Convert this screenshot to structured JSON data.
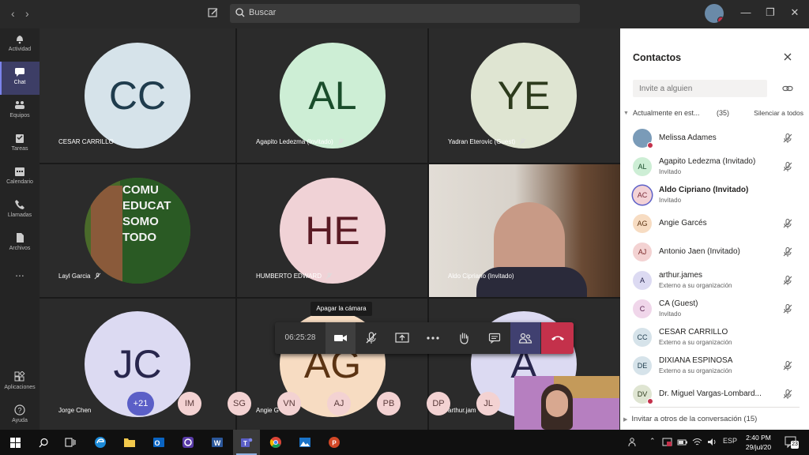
{
  "search": {
    "placeholder": "Buscar"
  },
  "rail": {
    "items": [
      {
        "label": "Actividad",
        "icon": "bell-icon"
      },
      {
        "label": "Chat",
        "icon": "chat-icon"
      },
      {
        "label": "Equipos",
        "icon": "teams-icon"
      },
      {
        "label": "Tareas",
        "icon": "tasks-icon"
      },
      {
        "label": "Calendario",
        "icon": "calendar-icon"
      },
      {
        "label": "Llamadas",
        "icon": "phone-icon"
      },
      {
        "label": "Archivos",
        "icon": "files-icon"
      },
      {
        "label": "Aplicaciones",
        "icon": "apps-icon"
      },
      {
        "label": "Ayuda",
        "icon": "help-icon"
      }
    ],
    "more": "..."
  },
  "tiles": [
    {
      "initials": "CC",
      "name": "CESAR CARRILLO",
      "bg": "#d6e3ea",
      "fg": "#1f3c4d"
    },
    {
      "initials": "AL",
      "name": "Agapito Ledezma (Invitado)",
      "bg": "#cdeed5",
      "fg": "#1a4d2b"
    },
    {
      "initials": "YE",
      "name": "Yadran Eterovic (Guest)",
      "bg": "#dfe5d2",
      "fg": "#2c3a1c"
    },
    {
      "initials": "",
      "name": "Layl Garcia",
      "bg": "#4a6a2a",
      "fg": "#ffffff",
      "photo_text": "COMU EDUCAT SOMO TODO"
    },
    {
      "initials": "HE",
      "name": "HUMBERTO EDWARD",
      "bg": "#f0d2d6",
      "fg": "#5a1a24"
    },
    {
      "initials": "",
      "name": "Aldo Cipriano (Invitado)",
      "bg": "#d8d0c8",
      "fg": "#ffffff"
    },
    {
      "initials": "JC",
      "name": "Jorge Chen",
      "bg": "#dcdaf2",
      "fg": "#28264d"
    },
    {
      "initials": "AG",
      "name": "Angie G",
      "bg": "#f7dcc2",
      "fg": "#5c3413"
    },
    {
      "initials": "A",
      "name": "arthur.jam",
      "bg": "#dcdaf2",
      "fg": "#28264d"
    }
  ],
  "tooltip": "Apagar la cámara",
  "controls": {
    "timer": "06:25:28"
  },
  "overflow": {
    "count": "+21",
    "avatars": [
      {
        "initials": "IM",
        "bg": "#f3d2d2"
      },
      {
        "initials": "SG",
        "bg": "#f3d2d2"
      },
      {
        "initials": "VN",
        "bg": "#f3d2d2"
      },
      {
        "initials": "AJ",
        "bg": "#f3d2d2"
      },
      {
        "initials": "PB",
        "bg": "#f3d2d2"
      },
      {
        "initials": "DP",
        "bg": "#f3d2d2"
      },
      {
        "initials": "JL",
        "bg": "#f3d2d2"
      }
    ]
  },
  "panel": {
    "title": "Contactos",
    "invite_placeholder": "Invite a alguien",
    "section_label": "Actualmente en est...",
    "section_count": "(35)",
    "mute_all": "Silenciar a todos",
    "contacts": [
      {
        "initials": "",
        "name": "Melissa Adames",
        "sub": "",
        "bg": "#7a9bb8",
        "fg": "#ffffff",
        "bold": false
      },
      {
        "initials": "AL",
        "name": "Agapito Ledezma (Invitado)",
        "sub": "Invitado",
        "bg": "#cdeed5",
        "fg": "#1a4d2b",
        "bold": false
      },
      {
        "initials": "AC",
        "name": "Aldo Cipriano (Invitado)",
        "sub": "Invitado",
        "bg": "#f3d2d6",
        "fg": "#7a2a36",
        "bold": true
      },
      {
        "initials": "AG",
        "name": "Angie Garcés",
        "sub": "",
        "bg": "#f7dcc2",
        "fg": "#5c3413",
        "bold": false
      },
      {
        "initials": "AJ",
        "name": "Antonio Jaen (Invitado)",
        "sub": "",
        "bg": "#f3d2d2",
        "fg": "#7a2a2a",
        "bold": false
      },
      {
        "initials": "A",
        "name": "arthur.james",
        "sub": "Externo a su organización",
        "bg": "#dcdaf2",
        "fg": "#28264d",
        "bold": false
      },
      {
        "initials": "C",
        "name": "CA (Guest)",
        "sub": "Invitado",
        "bg": "#f0d6ea",
        "fg": "#5a2450",
        "bold": false
      },
      {
        "initials": "CC",
        "name": "CESAR CARRILLO",
        "sub": "Externo a su organización",
        "bg": "#d6e3ea",
        "fg": "#1f3c4d",
        "bold": false
      },
      {
        "initials": "DE",
        "name": "DIXIANA ESPINOSA",
        "sub": "Externo a su organización",
        "bg": "#d6e3ea",
        "fg": "#1f3c4d",
        "bold": false
      },
      {
        "initials": "DV",
        "name": "Dr. Miguel Vargas-Lombard...",
        "sub": "",
        "bg": "#dfe5d2",
        "fg": "#2c3a1c",
        "bold": false
      }
    ],
    "invite_others": "Invitar a otros de la conversación (15)"
  },
  "taskbar": {
    "tray": {
      "lang": "ESP",
      "notifications": "23"
    },
    "time": "2:40 PM",
    "date": "29/jul/20"
  }
}
